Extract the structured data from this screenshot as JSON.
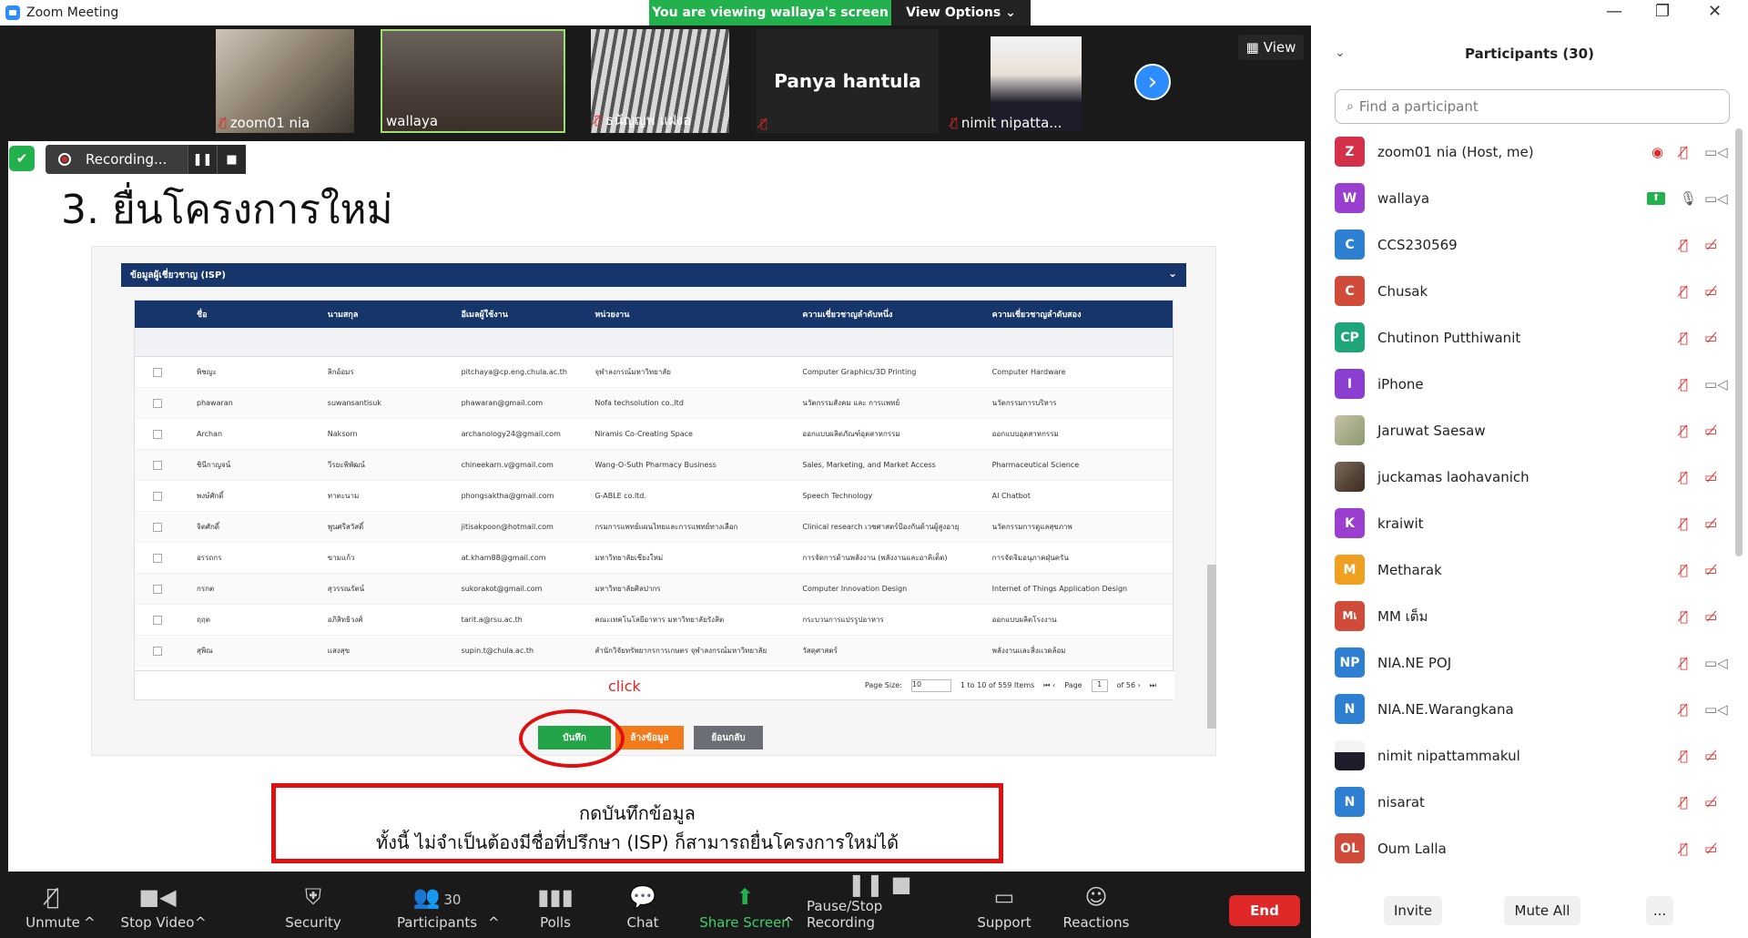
{
  "window": {
    "title": "Zoom Meeting"
  },
  "banner": {
    "viewing": "You are viewing wallaya's screen",
    "view_options": "View Options ⌄"
  },
  "gallery": {
    "view_label": "View",
    "tiles": [
      {
        "name": "zoom01 nia"
      },
      {
        "name": "wallaya"
      },
      {
        "name": "ธนัญญพ  แฝงอ"
      },
      {
        "name": "Panya hantula"
      },
      {
        "name": "nimit nipatta..."
      }
    ]
  },
  "recording": {
    "label": "Recording..."
  },
  "slide": {
    "title": "3. ยื่นโครงการใหม่",
    "form_header": "ข้อมูลผู้เชี่ยวชาญ (ISP)",
    "columns": [
      "ชื่อ",
      "นามสกุล",
      "อีเมลผู้ใช้งาน",
      "หน่วยงาน",
      "ความเชี่ยวชาญลำดับหนึ่ง",
      "ความเชี่ยวชาญลำดับสอง"
    ],
    "rows": [
      [
        "พิชญะ",
        "ลิกอ้อมร",
        "pitchaya@cp.eng.chula.ac.th",
        "จุฬาลงกรณ์มหาวิทยาลัย",
        "Computer Graphics/3D Printing",
        "Computer Hardware"
      ],
      [
        "phawaran",
        "suwansantisuk",
        "phawaran@gmail.com",
        "Nofa techsolution co.,ltd",
        "นวัตกรรมสังคม และ การแพทย์",
        "นวัตกรรมการบริหาร"
      ],
      [
        "Archan",
        "Naksorn",
        "archanology24@gmail.com",
        "Niramis Co-Creating Space",
        "ออกแบบผลิตภัณฑ์อุตสาหกรรม",
        "ออกแบบอุตสาหกรรม"
      ],
      [
        "ชินีกาญจน์",
        "วีรยะพิพัฒน์",
        "chineekarn.v@gmail.com",
        "Wang-O-Suth Pharmacy Business",
        "Sales, Marketing, and Market Access",
        "Pharmaceutical Science"
      ],
      [
        "พงษ์ศักดิ์",
        "ทาตะนาม",
        "phongsaktha@gmail.com",
        "G-ABLE co.ltd.",
        "Speech Technology",
        "AI Chatbot"
      ],
      [
        "จิตศักดิ์",
        "พูนศรีสวัสดิ์",
        "jitisakpoon@hotmail.com",
        "กรมการแพทย์แผนไทยและการแพทย์ทางเลือก",
        "Clinical research เวชศาสตร์ป้องกันด้านผู้สูงอายุ",
        "นวัตกรรมการดูแลสุขภาพ"
      ],
      [
        "อรรถกร",
        "ขามแก้ว",
        "at.kham88@gmail.com",
        "มหาวิทยาลัยเชียงใหม่",
        "การจัดการด้านพลังงาน (พลังงานและอาคิเต็ด)",
        "การจัดจิมอนุภาคฝุ่นครัน"
      ],
      [
        "กรกต",
        "สุวรรณรัตน์",
        "sukorakot@gmail.com",
        "มหาวิทยาลัยศิลปากร",
        "Computer Innovation Design",
        "Internet of Things Application Design"
      ],
      [
        "ฤฤต",
        "อภิสิทธิวงศ์",
        "tarit.a@rsu.ac.th",
        "คณะเทคโนโลยีอาหาร มหาวิทยาลัยรังสิต",
        "กระบวนการแปรรูปอาหาร",
        "ออกแบบผลิตโรงงาน"
      ],
      [
        "สุพิณ",
        "แสงสุข",
        "supin.t@chula.ac.th",
        "สำนักวิจัยทรัพยากรการเกษตร จุฬาลงกรณ์มหาวิทยาลัย",
        "วัสดุศาสตร์",
        "พลังงานและสิ่งแวดล้อม"
      ]
    ],
    "pager": {
      "page_size_label": "Page Size:",
      "page_size": "10",
      "range": "1 to 10 of 559 Items",
      "page_label": "Page",
      "page": "1",
      "of": "of 56 ›",
      "first": "⏮ ‹",
      "last": "⏭"
    },
    "click_label": "click",
    "btn_save": "บันทึก",
    "btn_clear": "ล้างข้อมูล",
    "btn_back": "ย้อนกลับ",
    "note_line1": "กดบันทึกข้อมูล",
    "note_line2": "ทั้งนี้ ไม่จำเป็นต้องมีชื่อที่ปรึกษา (ISP) ก็สามารถยื่นโครงการใหม่ได้"
  },
  "toolbar": {
    "unmute": "Unmute",
    "stop_video": "Stop Video",
    "security": "Security",
    "participants": "Participants",
    "participants_count": "30",
    "polls": "Polls",
    "chat": "Chat",
    "share_screen": "Share Screen",
    "pause_recording": "Pause/Stop Recording",
    "support": "Support",
    "reactions": "Reactions",
    "end": "End"
  },
  "panel": {
    "title": "Participants (30)",
    "search_placeholder": "Find a participant",
    "invite": "Invite",
    "mute_all": "Mute All",
    "more": "...",
    "participants": [
      {
        "initials": "Z",
        "name": "zoom01 nia (Host, me)",
        "color": "#d4304a"
      },
      {
        "initials": "W",
        "name": "wallaya",
        "color": "#9b3fd1"
      },
      {
        "initials": "C",
        "name": "CCS230569",
        "color": "#2d7fd1"
      },
      {
        "initials": "C",
        "name": "Chusak",
        "color": "#d14b3a"
      },
      {
        "initials": "CP",
        "name": "Chutinon Putthiwanit",
        "color": "#1ea67a"
      },
      {
        "initials": "I",
        "name": "iPhone",
        "color": "#8a3fd1"
      },
      {
        "initials": "",
        "name": "Jaruwat Saesaw",
        "color": "#b8b09a"
      },
      {
        "initials": "",
        "name": "juckamas laohavanich",
        "color": "#5a4a3a"
      },
      {
        "initials": "K",
        "name": "kraiwit",
        "color": "#9b3fd1"
      },
      {
        "initials": "M",
        "name": "Metharak",
        "color": "#f0a020"
      },
      {
        "initials": "Mเ",
        "name": "MM เต็ม",
        "color": "#d14b3a"
      },
      {
        "initials": "NP",
        "name": "NIA.NE POJ",
        "color": "#2d7fd1"
      },
      {
        "initials": "N",
        "name": "NIA.NE.Warangkana",
        "color": "#2d7fd1"
      },
      {
        "initials": "",
        "name": "nimit nipattammakul",
        "color": "#ffffff"
      },
      {
        "initials": "N",
        "name": "nisarat",
        "color": "#2d7fd1"
      },
      {
        "initials": "OL",
        "name": "Oum Lalla",
        "color": "#d14b3a"
      }
    ]
  }
}
